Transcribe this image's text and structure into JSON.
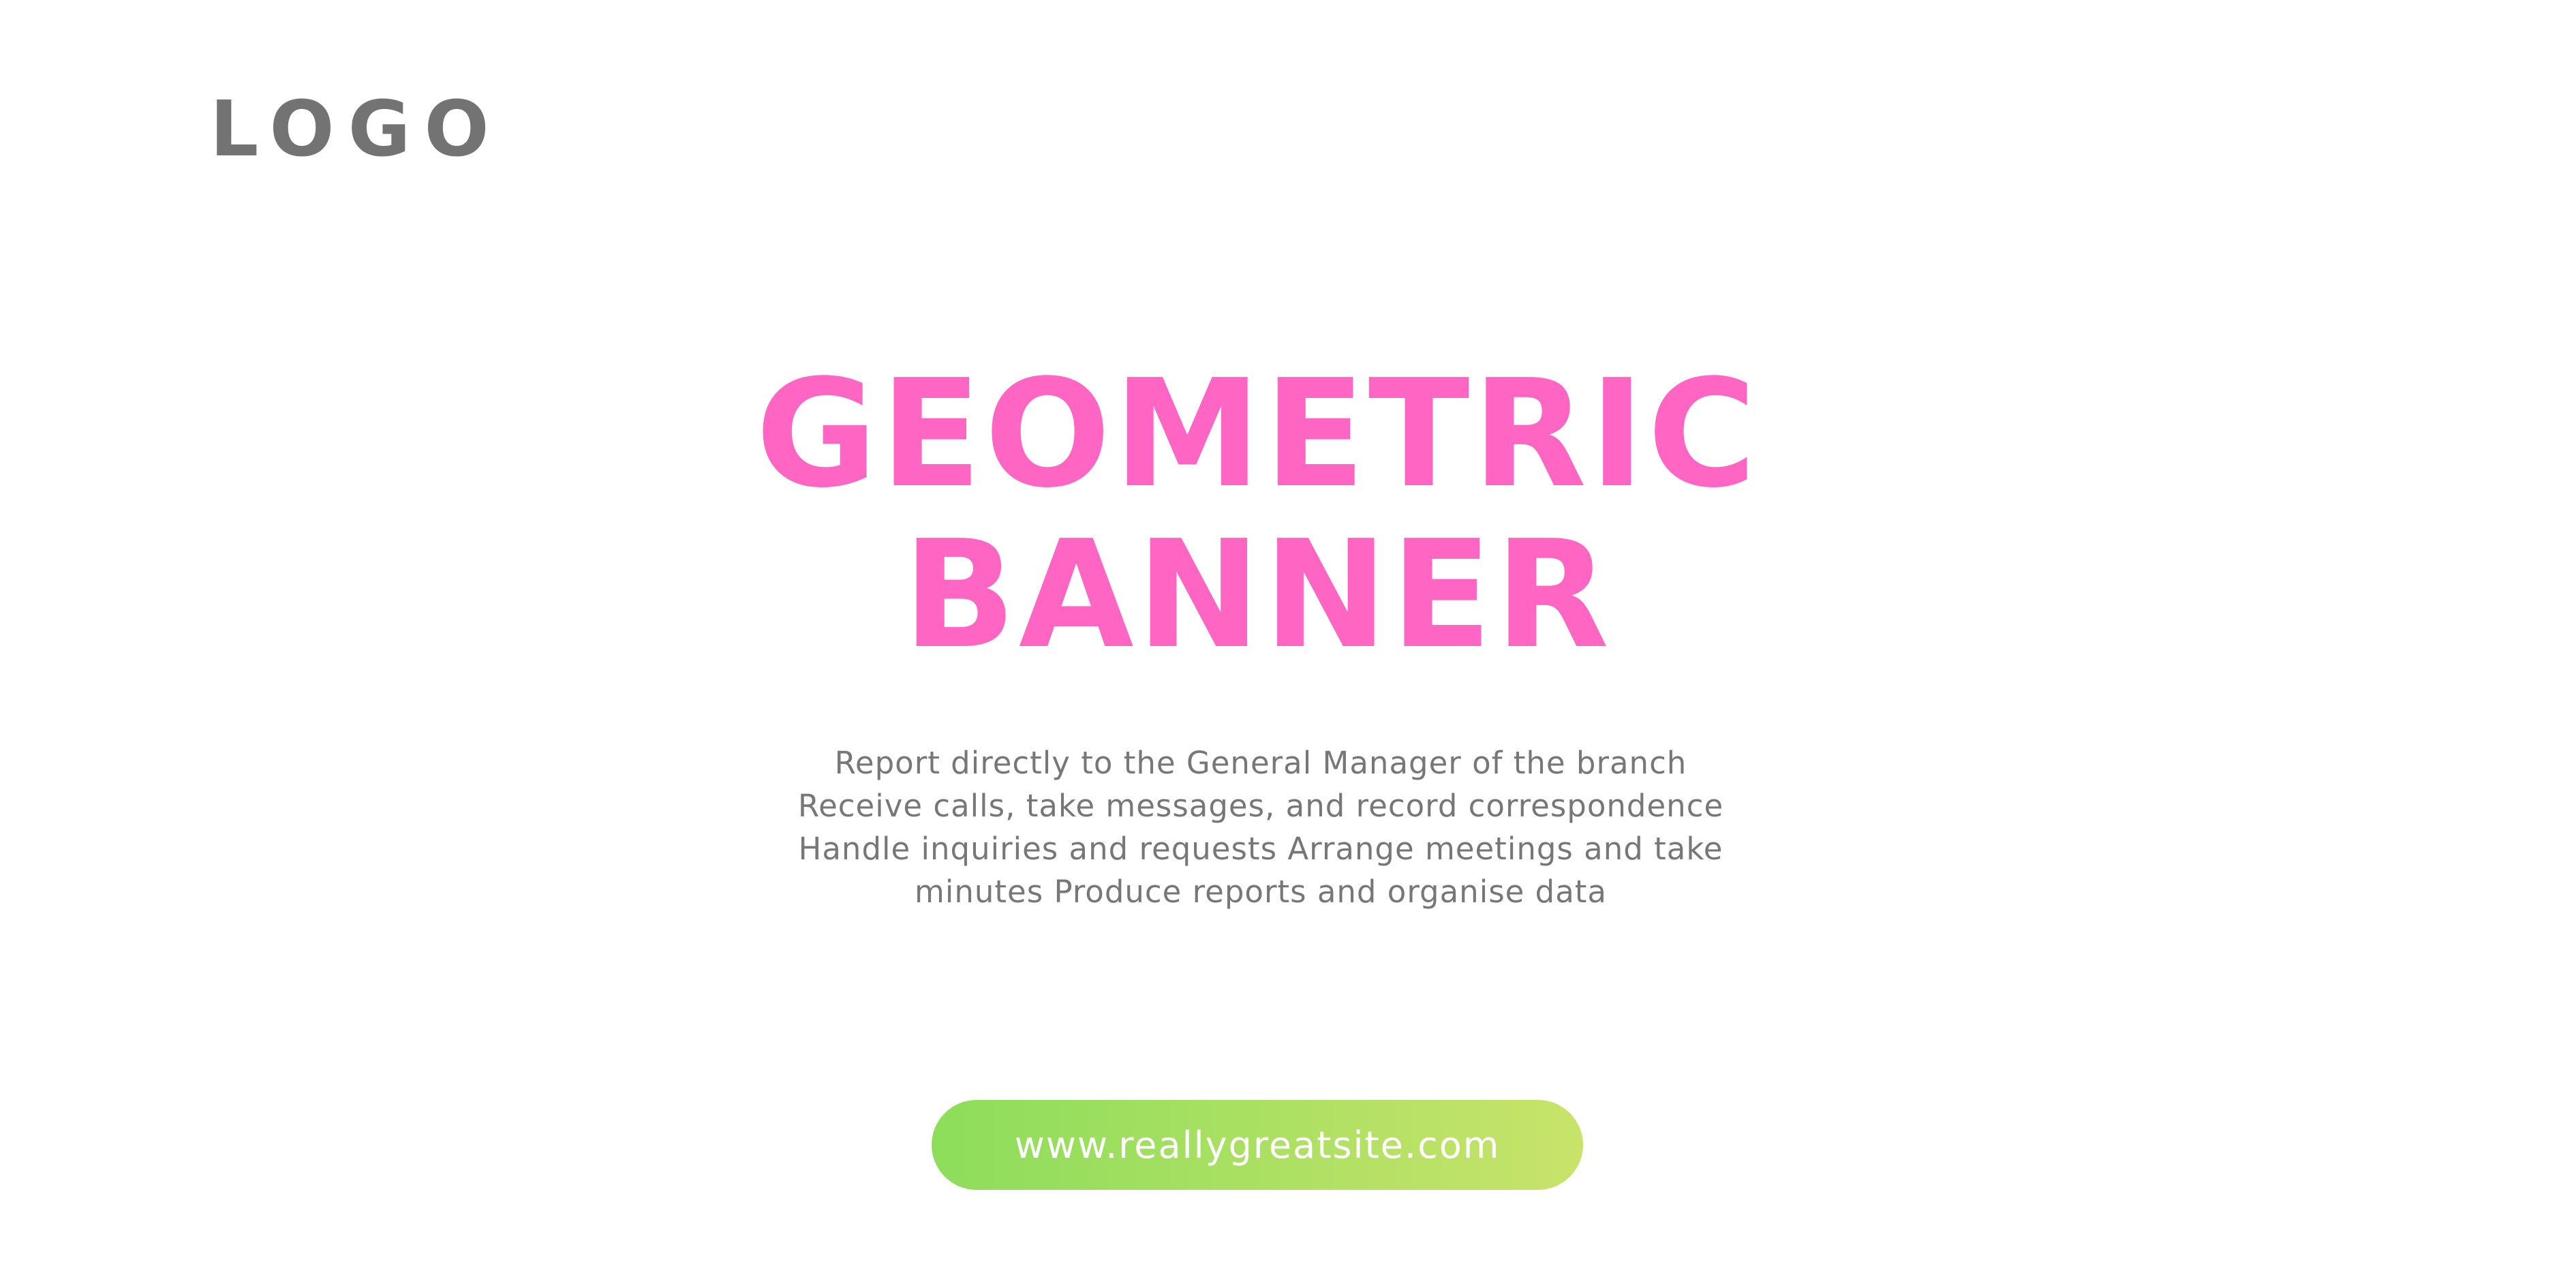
{
  "logo": {
    "text": "LOGO"
  },
  "headline": {
    "line1": "GEOMETRIC",
    "line2": "BANNER"
  },
  "description": {
    "text": "Report directly to the General Manager of the branch Receive calls, take messages, and record correspondence Handle inquiries and requests Arrange meetings and take minutes Produce reports and organise data"
  },
  "cta": {
    "label": "www.reallygreatsite.com"
  },
  "colors": {
    "headline": "#ff66c4",
    "logo": "#737373",
    "body_text": "#777777",
    "cta_gradient_start": "#8ddd5b",
    "cta_gradient_end": "#c8e36a",
    "background": "#ffffff"
  }
}
